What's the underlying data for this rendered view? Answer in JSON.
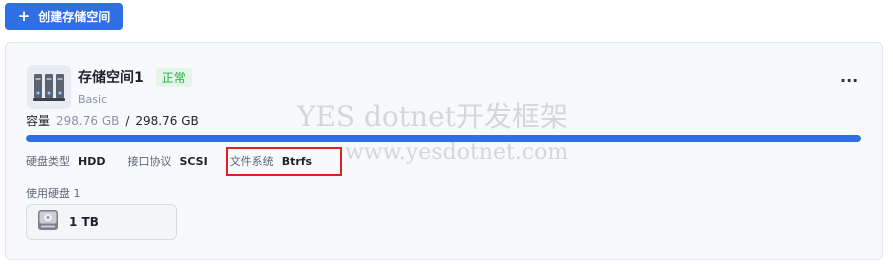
{
  "toolbar": {
    "create_label": "创建存储空间",
    "plus_icon": "+"
  },
  "storage": {
    "name": "存储空间1",
    "status": "正常",
    "type": "Basic",
    "more_icon": "···",
    "capacity": {
      "label": "容量",
      "used": "298.76 GB",
      "separator": "/",
      "total": "298.76 GB",
      "fill_percent": 100
    },
    "properties": [
      {
        "key": "硬盘类型",
        "value": "HDD"
      },
      {
        "key": "接口协议",
        "value": "SCSI"
      },
      {
        "key": "文件系统",
        "value": "Btrfs"
      }
    ],
    "disks_label": "使用硬盘 1",
    "disk": {
      "size": "1 TB"
    }
  },
  "watermark": {
    "line1": "YES dotnet开发框架",
    "line2": "www.yesdotnet.com"
  },
  "colors": {
    "accent": "#2f6fe4",
    "status_green": "#2bab46",
    "highlight_red": "#e02020"
  }
}
